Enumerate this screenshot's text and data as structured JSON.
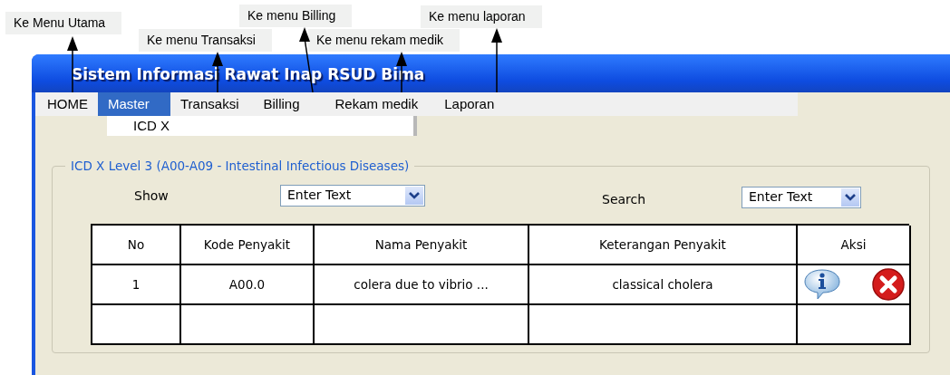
{
  "annotations": [
    {
      "label": "Ke Menu Utama"
    },
    {
      "label": "Ke menu Transaksi"
    },
    {
      "label": "Ke menu Billing"
    },
    {
      "label": "Ke menu rekam medik"
    },
    {
      "label": "Ke menu laporan"
    }
  ],
  "window": {
    "title": "Sistem Informasi Rawat Inap RSUD Bima"
  },
  "menu": [
    {
      "label": "HOME",
      "selected": false
    },
    {
      "label": "Master",
      "selected": true
    },
    {
      "label": "Transaksi",
      "selected": false
    },
    {
      "label": "Billing",
      "selected": false
    },
    {
      "label": "Rekam medik",
      "selected": false
    },
    {
      "label": "Laporan",
      "selected": false
    }
  ],
  "dropdown": {
    "items": [
      "ICD X"
    ]
  },
  "group": {
    "title": "ICD X Level 3 (A00-A09 - Intestinal Infectious Diseases)",
    "show": {
      "label": "Show",
      "value": "Enter Text"
    },
    "search": {
      "label": "Search",
      "value": "Enter Text"
    }
  },
  "table": {
    "columns": [
      "No",
      "Kode Penyakit",
      "Nama Penyakit",
      "Keterangan Penyakit",
      "Aksi"
    ],
    "rows": [
      {
        "cells": [
          "1",
          "A00.0",
          "colera due to vibrio ...",
          "classical cholera"
        ],
        "actions": [
          {
            "kind": "info"
          },
          {
            "kind": "delete"
          }
        ]
      },
      {}
    ]
  }
}
